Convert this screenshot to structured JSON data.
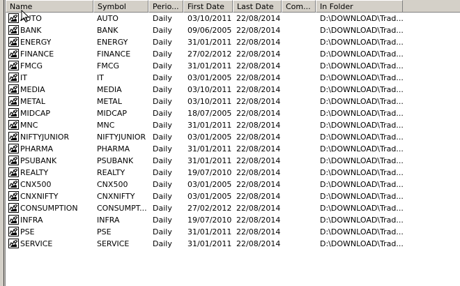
{
  "columns": {
    "name": "Name",
    "symbol": "Symbol",
    "periodicity": "Perio...",
    "first_date": "First Date",
    "last_date": "Last Date",
    "comment": "Com...",
    "in_folder": "In Folder"
  },
  "rows": [
    {
      "name": "AUTO",
      "symbol": "AUTO",
      "period": "Daily",
      "first": "03/10/2011",
      "last": "22/08/2014",
      "comment": "",
      "folder": "D:\\DOWNLOAD\\Trad..."
    },
    {
      "name": "BANK",
      "symbol": "BANK",
      "period": "Daily",
      "first": "09/06/2005",
      "last": "22/08/2014",
      "comment": "",
      "folder": "D:\\DOWNLOAD\\Trad..."
    },
    {
      "name": "ENERGY",
      "symbol": "ENERGY",
      "period": "Daily",
      "first": "31/01/2011",
      "last": "22/08/2014",
      "comment": "",
      "folder": "D:\\DOWNLOAD\\Trad..."
    },
    {
      "name": "FINANCE",
      "symbol": "FINANCE",
      "period": "Daily",
      "first": "27/02/2012",
      "last": "22/08/2014",
      "comment": "",
      "folder": "D:\\DOWNLOAD\\Trad..."
    },
    {
      "name": "FMCG",
      "symbol": "FMCG",
      "period": "Daily",
      "first": "31/01/2011",
      "last": "22/08/2014",
      "comment": "",
      "folder": "D:\\DOWNLOAD\\Trad..."
    },
    {
      "name": "IT",
      "symbol": "IT",
      "period": "Daily",
      "first": "03/01/2005",
      "last": "22/08/2014",
      "comment": "",
      "folder": "D:\\DOWNLOAD\\Trad..."
    },
    {
      "name": "MEDIA",
      "symbol": "MEDIA",
      "period": "Daily",
      "first": "03/10/2011",
      "last": "22/08/2014",
      "comment": "",
      "folder": "D:\\DOWNLOAD\\Trad..."
    },
    {
      "name": "METAL",
      "symbol": "METAL",
      "period": "Daily",
      "first": "03/10/2011",
      "last": "22/08/2014",
      "comment": "",
      "folder": "D:\\DOWNLOAD\\Trad..."
    },
    {
      "name": "MIDCAP",
      "symbol": "MIDCAP",
      "period": "Daily",
      "first": "18/07/2005",
      "last": "22/08/2014",
      "comment": "",
      "folder": "D:\\DOWNLOAD\\Trad..."
    },
    {
      "name": "MNC",
      "symbol": "MNC",
      "period": "Daily",
      "first": "31/01/2011",
      "last": "22/08/2014",
      "comment": "",
      "folder": "D:\\DOWNLOAD\\Trad..."
    },
    {
      "name": "NIFTYJUNIOR",
      "symbol": "NIFTYJUNIOR",
      "period": "Daily",
      "first": "03/01/2005",
      "last": "22/08/2014",
      "comment": "",
      "folder": "D:\\DOWNLOAD\\Trad..."
    },
    {
      "name": "PHARMA",
      "symbol": "PHARMA",
      "period": "Daily",
      "first": "31/01/2011",
      "last": "22/08/2014",
      "comment": "",
      "folder": "D:\\DOWNLOAD\\Trad..."
    },
    {
      "name": "PSUBANK",
      "symbol": "PSUBANK",
      "period": "Daily",
      "first": "31/01/2011",
      "last": "22/08/2014",
      "comment": "",
      "folder": "D:\\DOWNLOAD\\Trad..."
    },
    {
      "name": "REALTY",
      "symbol": "REALTY",
      "period": "Daily",
      "first": "19/07/2010",
      "last": "22/08/2014",
      "comment": "",
      "folder": "D:\\DOWNLOAD\\Trad..."
    },
    {
      "name": "CNX500",
      "symbol": "CNX500",
      "period": "Daily",
      "first": "03/01/2005",
      "last": "22/08/2014",
      "comment": "",
      "folder": "D:\\DOWNLOAD\\Trad..."
    },
    {
      "name": "CNXNIFTY",
      "symbol": "CNXNIFTY",
      "period": "Daily",
      "first": "03/01/2005",
      "last": "22/08/2014",
      "comment": "",
      "folder": "D:\\DOWNLOAD\\Trad..."
    },
    {
      "name": "CONSUMPTION",
      "symbol": "CONSUMPT...",
      "period": "Daily",
      "first": "27/02/2012",
      "last": "22/08/2014",
      "comment": "",
      "folder": "D:\\DOWNLOAD\\Trad..."
    },
    {
      "name": "INFRA",
      "symbol": "INFRA",
      "period": "Daily",
      "first": "19/07/2010",
      "last": "22/08/2014",
      "comment": "",
      "folder": "D:\\DOWNLOAD\\Trad..."
    },
    {
      "name": "PSE",
      "symbol": "PSE",
      "period": "Daily",
      "first": "31/01/2011",
      "last": "22/08/2014",
      "comment": "",
      "folder": "D:\\DOWNLOAD\\Trad..."
    },
    {
      "name": "SERVICE",
      "symbol": "SERVICE",
      "period": "Daily",
      "first": "31/01/2011",
      "last": "22/08/2014",
      "comment": "",
      "folder": "D:\\DOWNLOAD\\Trad..."
    }
  ],
  "icons": {
    "row_icon": "bull-chart-icon",
    "cursor": "mouse-pointer-icon"
  }
}
